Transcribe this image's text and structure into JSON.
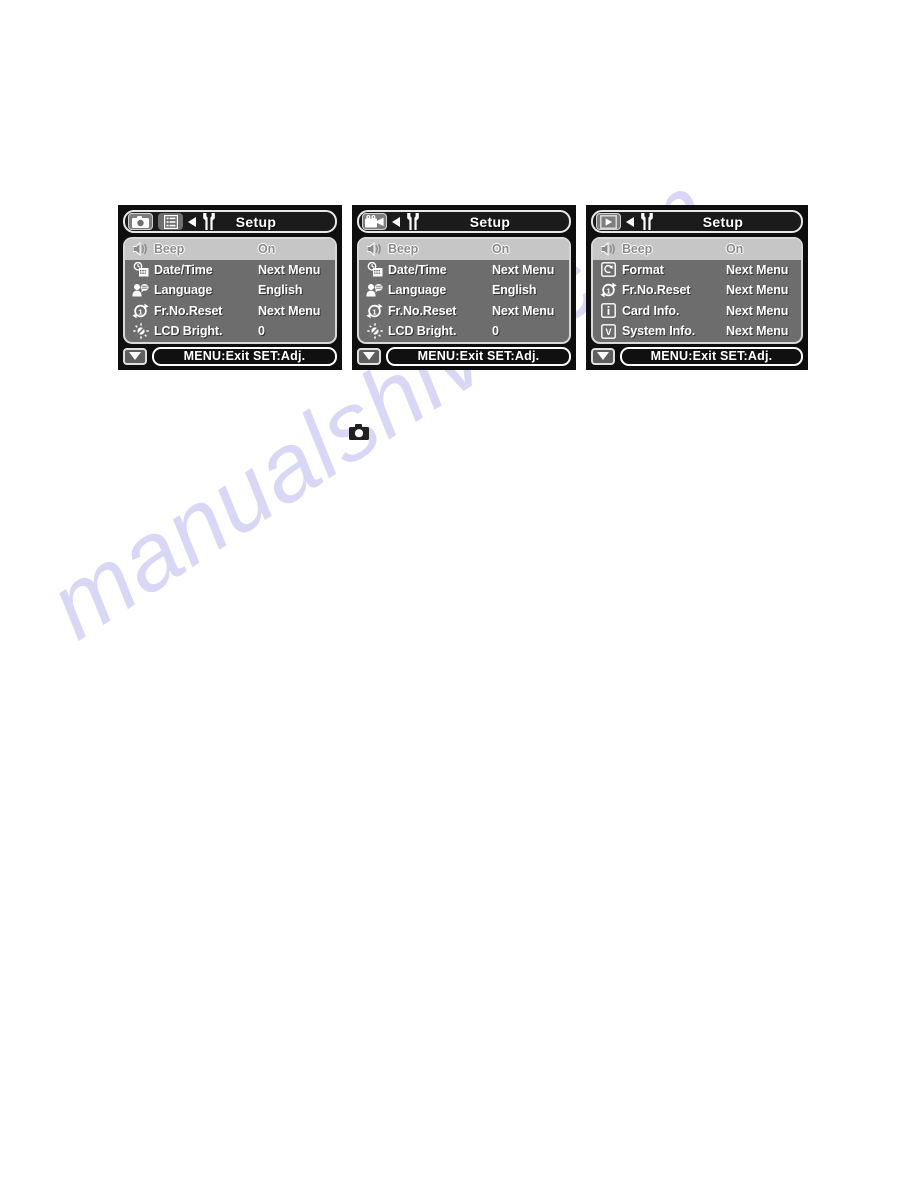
{
  "page": {
    "watermark": "manualshive.com",
    "caption_icon": "camera-icon"
  },
  "panels": [
    {
      "id": "still-capture-setup",
      "title": "Setup",
      "header_icons": [
        {
          "name": "camera-icon",
          "selected": true
        },
        {
          "name": "list-menu-icon",
          "selected": false
        },
        {
          "name": "left-arrow-icon",
          "selected": false
        },
        {
          "name": "wrench-setup-icon",
          "selected": false
        }
      ],
      "footer": {
        "scroll_indicator": "down-triangle-icon",
        "hint": "MENU:Exit  SET:Adj."
      },
      "rows": [
        {
          "icon": "speaker-beep-icon",
          "label": "Beep",
          "value": "On",
          "highlighted": true
        },
        {
          "icon": "clock-calendar-icon",
          "label": "Date/Time",
          "value": "Next Menu",
          "highlighted": false
        },
        {
          "icon": "people-language-icon",
          "label": "Language",
          "value": "English",
          "highlighted": false
        },
        {
          "icon": "reset-counter-icon",
          "label": "Fr.No.Reset",
          "value": "Next Menu",
          "highlighted": false
        },
        {
          "icon": "brightness-sun-icon",
          "label": "LCD Bright.",
          "value": "0",
          "highlighted": false
        }
      ]
    },
    {
      "id": "movie-capture-setup",
      "title": "Setup",
      "header_icons": [
        {
          "name": "movie-camera-icon",
          "selected": true
        },
        {
          "name": "left-arrow-icon",
          "selected": false
        },
        {
          "name": "wrench-setup-icon",
          "selected": false
        }
      ],
      "footer": {
        "scroll_indicator": "down-triangle-icon",
        "hint": "MENU:Exit  SET:Adj."
      },
      "rows": [
        {
          "icon": "speaker-beep-icon",
          "label": "Beep",
          "value": "On",
          "highlighted": true
        },
        {
          "icon": "clock-calendar-icon",
          "label": "Date/Time",
          "value": "Next Menu",
          "highlighted": false
        },
        {
          "icon": "people-language-icon",
          "label": "Language",
          "value": "English",
          "highlighted": false
        },
        {
          "icon": "reset-counter-icon",
          "label": "Fr.No.Reset",
          "value": "Next Menu",
          "highlighted": false
        },
        {
          "icon": "brightness-sun-icon",
          "label": "LCD Bright.",
          "value": "0",
          "highlighted": false
        }
      ]
    },
    {
      "id": "playback-setup",
      "title": "Setup",
      "header_icons": [
        {
          "name": "play-icon",
          "selected": true
        },
        {
          "name": "left-arrow-icon",
          "selected": false
        },
        {
          "name": "wrench-setup-icon",
          "selected": false
        }
      ],
      "footer": {
        "scroll_indicator": "down-triangle-icon",
        "hint": "MENU:Exit  SET:Adj."
      },
      "rows": [
        {
          "icon": "speaker-beep-icon",
          "label": "Beep",
          "value": "On",
          "highlighted": true
        },
        {
          "icon": "format-card-icon",
          "label": "Format",
          "value": "Next Menu",
          "highlighted": false
        },
        {
          "icon": "reset-counter-icon",
          "label": "Fr.No.Reset",
          "value": "Next Menu",
          "highlighted": false
        },
        {
          "icon": "card-info-icon",
          "label": "Card Info.",
          "value": "Next Menu",
          "highlighted": false
        },
        {
          "icon": "system-info-icon",
          "label": "System Info.",
          "value": "Next Menu",
          "highlighted": false
        }
      ]
    }
  ],
  "colors": {
    "lcd_background": "#0e0e0e",
    "list_background": "#6d6d6d",
    "highlight_row": "#c6c6c6",
    "border": "#d9d9d9",
    "text": "#ffffff",
    "watermark": "#d8d8f6"
  }
}
